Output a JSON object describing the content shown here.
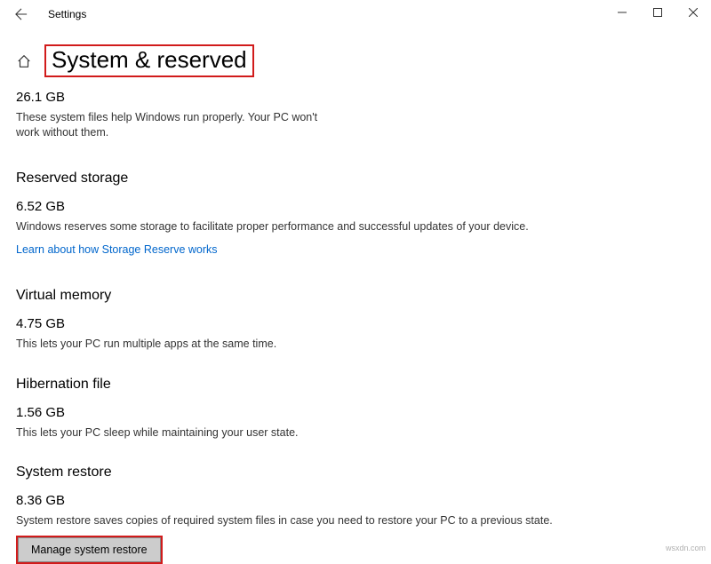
{
  "titlebar": {
    "app_title": "Settings"
  },
  "page": {
    "title": "System & reserved"
  },
  "system_files": {
    "size": "26.1 GB",
    "desc": "These system files help Windows run properly. Your PC won't work without them."
  },
  "reserved_storage": {
    "heading": "Reserved storage",
    "size": "6.52 GB",
    "desc": "Windows reserves some storage to facilitate proper performance and successful updates of your device.",
    "link": "Learn about how Storage Reserve works"
  },
  "virtual_memory": {
    "heading": "Virtual memory",
    "size": "4.75 GB",
    "desc": "This lets your PC run multiple apps at the same time."
  },
  "hibernation": {
    "heading": "Hibernation file",
    "size": "1.56 GB",
    "desc": "This lets your PC sleep while maintaining your user state."
  },
  "system_restore": {
    "heading": "System restore",
    "size": "8.36 GB",
    "desc": "System restore saves copies of required system files in case you need to restore your PC to a previous state.",
    "button": "Manage system restore"
  },
  "watermark": "wsxdn.com"
}
